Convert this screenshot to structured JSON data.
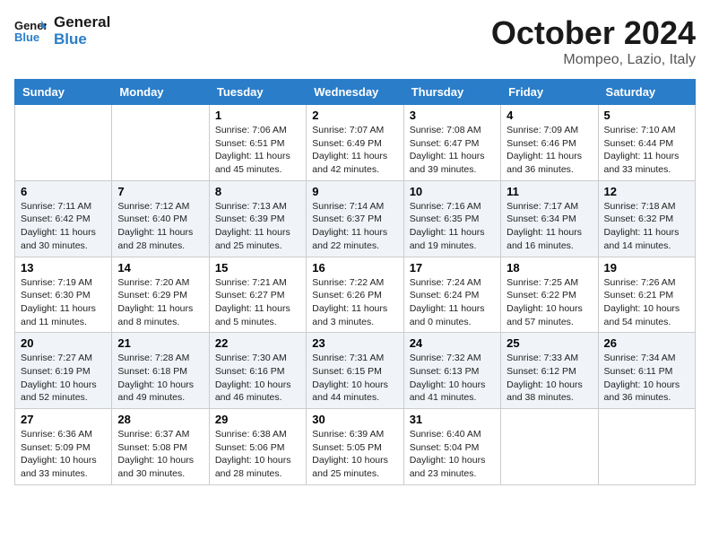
{
  "header": {
    "logo_line1": "General",
    "logo_line2": "Blue",
    "month": "October 2024",
    "location": "Mompeo, Lazio, Italy"
  },
  "weekdays": [
    "Sunday",
    "Monday",
    "Tuesday",
    "Wednesday",
    "Thursday",
    "Friday",
    "Saturday"
  ],
  "weeks": [
    [
      {
        "day": "",
        "sunrise": "",
        "sunset": "",
        "daylight": ""
      },
      {
        "day": "",
        "sunrise": "",
        "sunset": "",
        "daylight": ""
      },
      {
        "day": "1",
        "sunrise": "Sunrise: 7:06 AM",
        "sunset": "Sunset: 6:51 PM",
        "daylight": "Daylight: 11 hours and 45 minutes."
      },
      {
        "day": "2",
        "sunrise": "Sunrise: 7:07 AM",
        "sunset": "Sunset: 6:49 PM",
        "daylight": "Daylight: 11 hours and 42 minutes."
      },
      {
        "day": "3",
        "sunrise": "Sunrise: 7:08 AM",
        "sunset": "Sunset: 6:47 PM",
        "daylight": "Daylight: 11 hours and 39 minutes."
      },
      {
        "day": "4",
        "sunrise": "Sunrise: 7:09 AM",
        "sunset": "Sunset: 6:46 PM",
        "daylight": "Daylight: 11 hours and 36 minutes."
      },
      {
        "day": "5",
        "sunrise": "Sunrise: 7:10 AM",
        "sunset": "Sunset: 6:44 PM",
        "daylight": "Daylight: 11 hours and 33 minutes."
      }
    ],
    [
      {
        "day": "6",
        "sunrise": "Sunrise: 7:11 AM",
        "sunset": "Sunset: 6:42 PM",
        "daylight": "Daylight: 11 hours and 30 minutes."
      },
      {
        "day": "7",
        "sunrise": "Sunrise: 7:12 AM",
        "sunset": "Sunset: 6:40 PM",
        "daylight": "Daylight: 11 hours and 28 minutes."
      },
      {
        "day": "8",
        "sunrise": "Sunrise: 7:13 AM",
        "sunset": "Sunset: 6:39 PM",
        "daylight": "Daylight: 11 hours and 25 minutes."
      },
      {
        "day": "9",
        "sunrise": "Sunrise: 7:14 AM",
        "sunset": "Sunset: 6:37 PM",
        "daylight": "Daylight: 11 hours and 22 minutes."
      },
      {
        "day": "10",
        "sunrise": "Sunrise: 7:16 AM",
        "sunset": "Sunset: 6:35 PM",
        "daylight": "Daylight: 11 hours and 19 minutes."
      },
      {
        "day": "11",
        "sunrise": "Sunrise: 7:17 AM",
        "sunset": "Sunset: 6:34 PM",
        "daylight": "Daylight: 11 hours and 16 minutes."
      },
      {
        "day": "12",
        "sunrise": "Sunrise: 7:18 AM",
        "sunset": "Sunset: 6:32 PM",
        "daylight": "Daylight: 11 hours and 14 minutes."
      }
    ],
    [
      {
        "day": "13",
        "sunrise": "Sunrise: 7:19 AM",
        "sunset": "Sunset: 6:30 PM",
        "daylight": "Daylight: 11 hours and 11 minutes."
      },
      {
        "day": "14",
        "sunrise": "Sunrise: 7:20 AM",
        "sunset": "Sunset: 6:29 PM",
        "daylight": "Daylight: 11 hours and 8 minutes."
      },
      {
        "day": "15",
        "sunrise": "Sunrise: 7:21 AM",
        "sunset": "Sunset: 6:27 PM",
        "daylight": "Daylight: 11 hours and 5 minutes."
      },
      {
        "day": "16",
        "sunrise": "Sunrise: 7:22 AM",
        "sunset": "Sunset: 6:26 PM",
        "daylight": "Daylight: 11 hours and 3 minutes."
      },
      {
        "day": "17",
        "sunrise": "Sunrise: 7:24 AM",
        "sunset": "Sunset: 6:24 PM",
        "daylight": "Daylight: 11 hours and 0 minutes."
      },
      {
        "day": "18",
        "sunrise": "Sunrise: 7:25 AM",
        "sunset": "Sunset: 6:22 PM",
        "daylight": "Daylight: 10 hours and 57 minutes."
      },
      {
        "day": "19",
        "sunrise": "Sunrise: 7:26 AM",
        "sunset": "Sunset: 6:21 PM",
        "daylight": "Daylight: 10 hours and 54 minutes."
      }
    ],
    [
      {
        "day": "20",
        "sunrise": "Sunrise: 7:27 AM",
        "sunset": "Sunset: 6:19 PM",
        "daylight": "Daylight: 10 hours and 52 minutes."
      },
      {
        "day": "21",
        "sunrise": "Sunrise: 7:28 AM",
        "sunset": "Sunset: 6:18 PM",
        "daylight": "Daylight: 10 hours and 49 minutes."
      },
      {
        "day": "22",
        "sunrise": "Sunrise: 7:30 AM",
        "sunset": "Sunset: 6:16 PM",
        "daylight": "Daylight: 10 hours and 46 minutes."
      },
      {
        "day": "23",
        "sunrise": "Sunrise: 7:31 AM",
        "sunset": "Sunset: 6:15 PM",
        "daylight": "Daylight: 10 hours and 44 minutes."
      },
      {
        "day": "24",
        "sunrise": "Sunrise: 7:32 AM",
        "sunset": "Sunset: 6:13 PM",
        "daylight": "Daylight: 10 hours and 41 minutes."
      },
      {
        "day": "25",
        "sunrise": "Sunrise: 7:33 AM",
        "sunset": "Sunset: 6:12 PM",
        "daylight": "Daylight: 10 hours and 38 minutes."
      },
      {
        "day": "26",
        "sunrise": "Sunrise: 7:34 AM",
        "sunset": "Sunset: 6:11 PM",
        "daylight": "Daylight: 10 hours and 36 minutes."
      }
    ],
    [
      {
        "day": "27",
        "sunrise": "Sunrise: 6:36 AM",
        "sunset": "Sunset: 5:09 PM",
        "daylight": "Daylight: 10 hours and 33 minutes."
      },
      {
        "day": "28",
        "sunrise": "Sunrise: 6:37 AM",
        "sunset": "Sunset: 5:08 PM",
        "daylight": "Daylight: 10 hours and 30 minutes."
      },
      {
        "day": "29",
        "sunrise": "Sunrise: 6:38 AM",
        "sunset": "Sunset: 5:06 PM",
        "daylight": "Daylight: 10 hours and 28 minutes."
      },
      {
        "day": "30",
        "sunrise": "Sunrise: 6:39 AM",
        "sunset": "Sunset: 5:05 PM",
        "daylight": "Daylight: 10 hours and 25 minutes."
      },
      {
        "day": "31",
        "sunrise": "Sunrise: 6:40 AM",
        "sunset": "Sunset: 5:04 PM",
        "daylight": "Daylight: 10 hours and 23 minutes."
      },
      {
        "day": "",
        "sunrise": "",
        "sunset": "",
        "daylight": ""
      },
      {
        "day": "",
        "sunrise": "",
        "sunset": "",
        "daylight": ""
      }
    ]
  ]
}
